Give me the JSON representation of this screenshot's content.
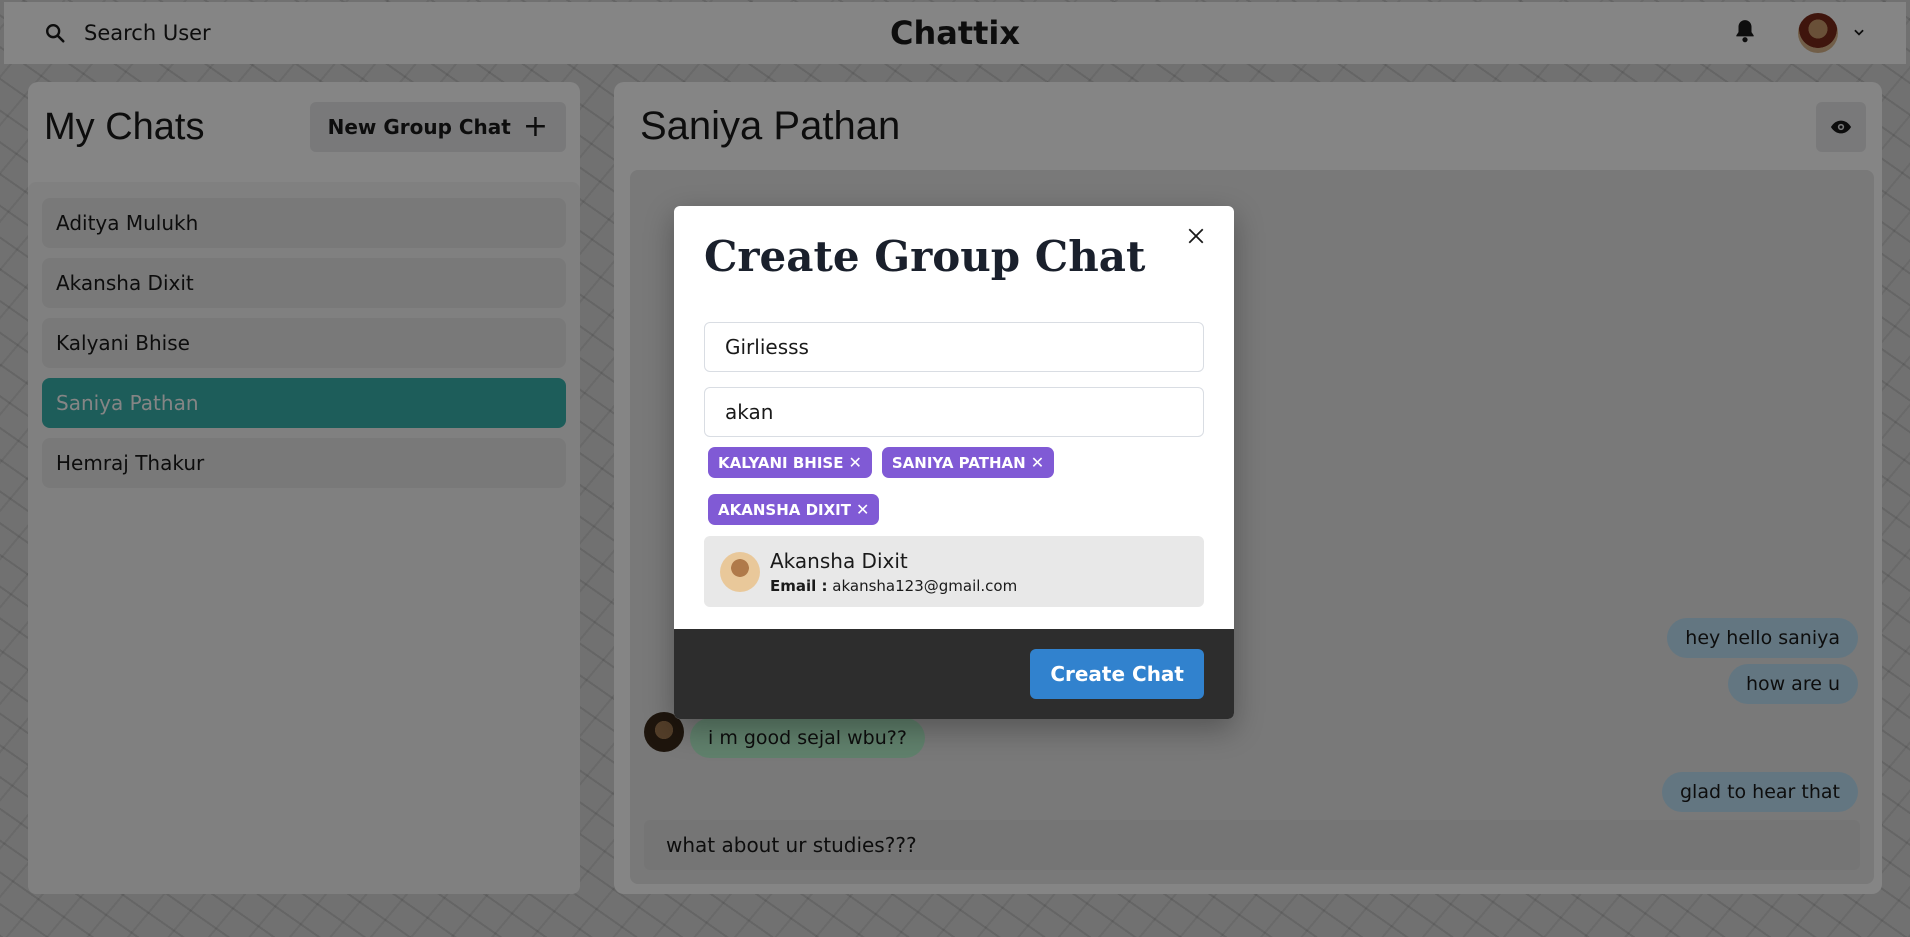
{
  "header": {
    "search_label": "Search User",
    "app_title": "Chattix"
  },
  "sidebar": {
    "title": "My Chats",
    "new_group_label": "New Group Chat",
    "chats": [
      {
        "label": "Aditya Mulukh"
      },
      {
        "label": "Akansha Dixit"
      },
      {
        "label": "Kalyani Bhise"
      },
      {
        "label": "Saniya Pathan"
      },
      {
        "label": "Hemraj Thakur"
      }
    ]
  },
  "chat": {
    "title": "Saniya Pathan",
    "messages": [
      {
        "text": "hey hello saniya",
        "direction": "sent"
      },
      {
        "text": "how are u",
        "direction": "sent"
      },
      {
        "text": "i m good sejal wbu??",
        "direction": "received"
      },
      {
        "text": "glad to hear that",
        "direction": "sent"
      }
    ],
    "compose_value": "what about ur studies???"
  },
  "modal": {
    "title": "Create Group Chat",
    "group_name_value": "Girliesss",
    "search_value": "akan",
    "selected_users": [
      {
        "label": "KALYANI BHISE"
      },
      {
        "label": "SANIYA PATHAN"
      },
      {
        "label": "AKANSHA DIXIT"
      }
    ],
    "search_result": {
      "name": "Akansha Dixit",
      "email_label": "Email :",
      "email": "akansha123@gmail.com"
    },
    "create_label": "Create Chat"
  },
  "colors": {
    "active_chat": "#38b2ac",
    "tag": "#805ad5",
    "primary_button": "#3182ce",
    "sent_bubble": "#bee3f8",
    "received_bubble": "#b9f5d0"
  },
  "icons": {
    "search": "search-icon",
    "bell": "bell-icon",
    "chevron": "chevron-down-icon",
    "eye": "eye-icon",
    "close": "close-icon",
    "plus": "plus-icon"
  }
}
